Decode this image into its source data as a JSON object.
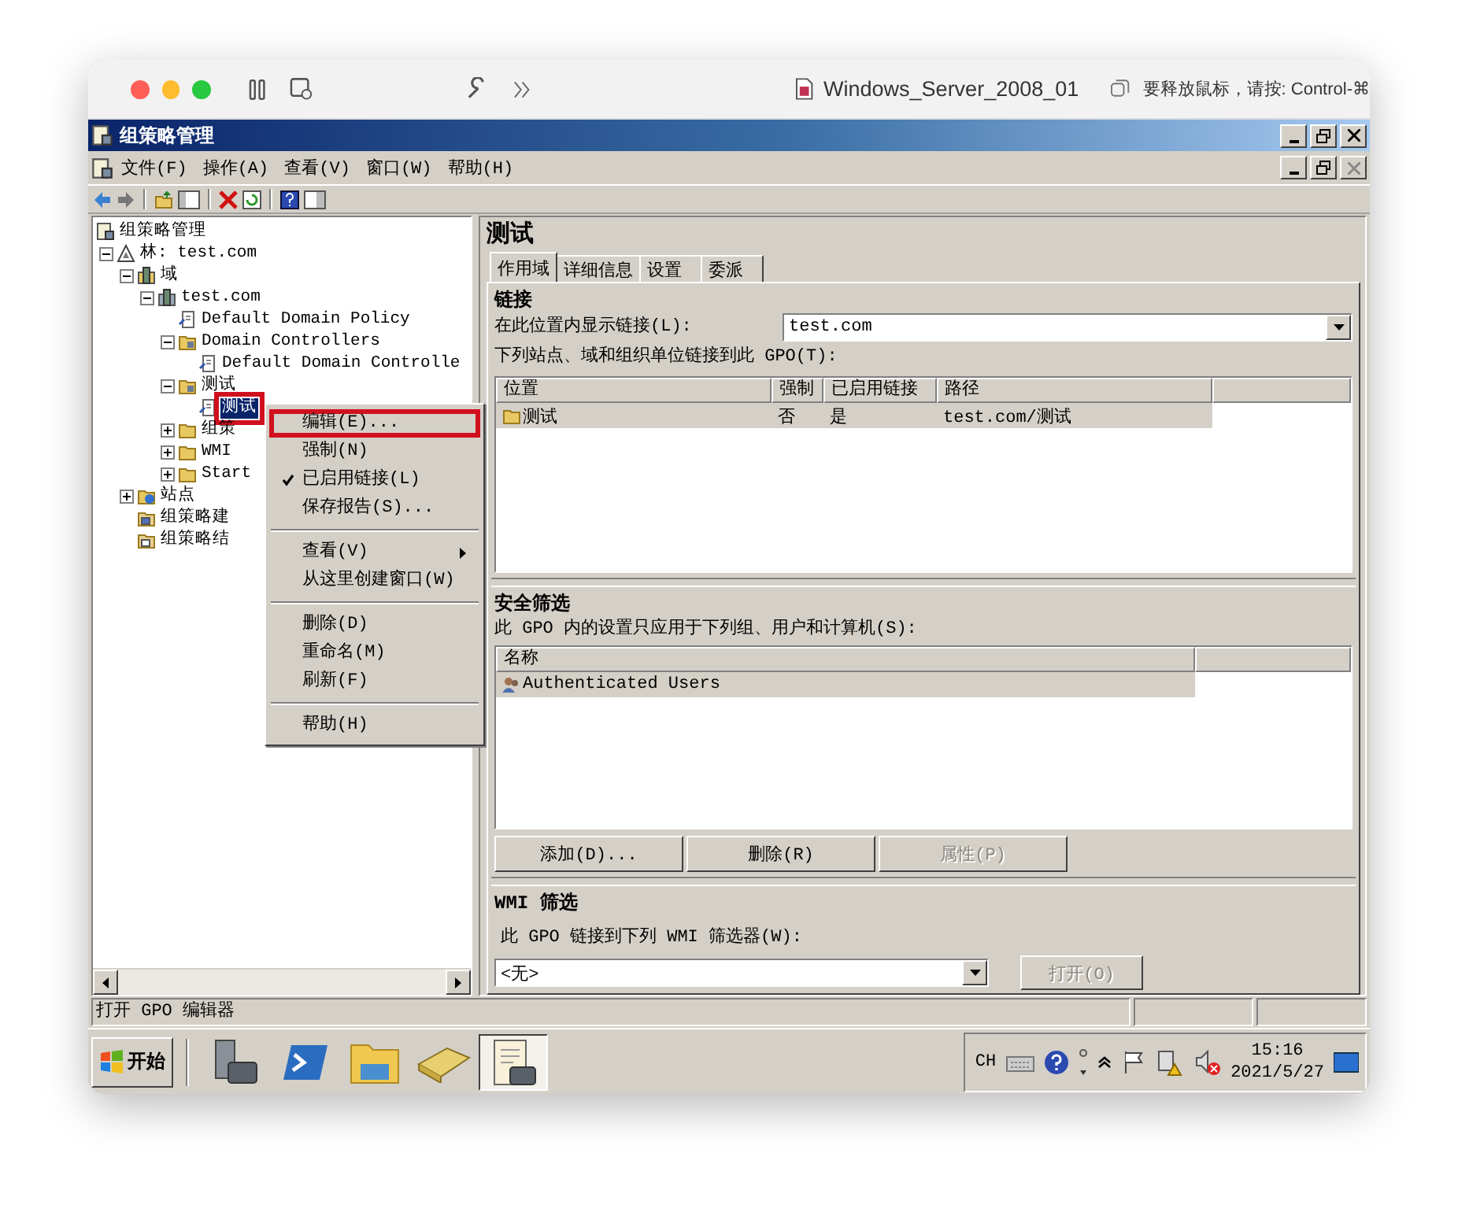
{
  "host_window": {
    "title": "Windows_Server_2008_01",
    "hint": "要释放鼠标，请按: Control-⌘"
  },
  "app_window": {
    "title": "组策略管理"
  },
  "menu_bar": [
    "文件(F)",
    "操作(A)",
    "查看(V)",
    "窗口(W)",
    "帮助(H)"
  ],
  "tree": {
    "label": "组策略管理",
    "kind": "console",
    "selected": false,
    "highlighted": false,
    "children": [
      {
        "label": "林: test.com",
        "kind": "forest",
        "expanded": true,
        "selected": false,
        "highlighted": false,
        "children": [
          {
            "label": "域",
            "kind": "domains",
            "expanded": true,
            "selected": false,
            "highlighted": false,
            "children": [
              {
                "label": "test.com",
                "kind": "domain",
                "expanded": true,
                "selected": false,
                "highlighted": false,
                "children": [
                  {
                    "label": "Default Domain Policy",
                    "kind": "gpo",
                    "selected": false,
                    "highlighted": false
                  },
                  {
                    "label": "Domain Controllers",
                    "kind": "ou",
                    "expanded": true,
                    "selected": false,
                    "highlighted": false,
                    "children": [
                      {
                        "label": "Default Domain Controlle",
                        "kind": "gpo",
                        "selected": false,
                        "highlighted": false
                      }
                    ]
                  },
                  {
                    "label": "测试",
                    "kind": "ou",
                    "expanded": true,
                    "selected": false,
                    "highlighted": false,
                    "children": [
                      {
                        "label": "测试",
                        "kind": "gpo",
                        "selected": true,
                        "highlighted": true
                      }
                    ]
                  },
                  {
                    "label": "组策",
                    "kind": "folder",
                    "expanded": false,
                    "selected": false,
                    "highlighted": false
                  },
                  {
                    "label": "WMI",
                    "kind": "folder",
                    "expanded": false,
                    "selected": false,
                    "highlighted": false
                  },
                  {
                    "label": "Start",
                    "kind": "folder",
                    "expanded": false,
                    "selected": false,
                    "highlighted": false
                  }
                ]
              }
            ]
          },
          {
            "label": "站点",
            "kind": "sites",
            "expanded": false,
            "selected": false,
            "highlighted": false
          },
          {
            "label": "组策略建",
            "kind": "modeling",
            "selected": false,
            "highlighted": false
          },
          {
            "label": "组策略结",
            "kind": "results",
            "selected": false,
            "highlighted": false
          }
        ]
      }
    ]
  },
  "details": {
    "title": "测试",
    "tabs": [
      {
        "label": "作用域",
        "selected": true
      },
      {
        "label": "详细信息",
        "selected": false
      },
      {
        "label": "设置",
        "selected": false
      },
      {
        "label": "委派",
        "selected": false
      }
    ],
    "links": {
      "heading": "链接",
      "location_label": "在此位置内显示链接(L):",
      "location_value": "test.com",
      "list_label": "下列站点、域和组织单位链接到此 GPO(T):",
      "columns": [
        "位置",
        "强制",
        "已启用链接",
        "路径"
      ],
      "rows": [
        {
          "cells": [
            "测试",
            "否",
            "是",
            "test.com/测试"
          ],
          "selected": true
        }
      ]
    },
    "security": {
      "heading": "安全筛选",
      "list_label": "此 GPO 内的设置只应用于下列组、用户和计算机(S):",
      "columns": [
        "名称"
      ],
      "rows": [
        {
          "cells": [
            "Authenticated Users"
          ],
          "selected": true
        }
      ],
      "buttons": [
        {
          "label": "添加(D)...",
          "disabled": false
        },
        {
          "label": "删除(R)",
          "disabled": false
        },
        {
          "label": "属性(P)",
          "disabled": true
        }
      ]
    },
    "wmi": {
      "heading": "WMI 筛选",
      "label": "此 GPO 链接到下列 WMI 筛选器(W):",
      "value": "<无>",
      "button": {
        "label": "打开(O)",
        "disabled": true
      }
    }
  },
  "context_menu": {
    "items": [
      {
        "kind": "item",
        "label": "编辑(E)...",
        "checked": false,
        "submenu": false,
        "highlighted": true
      },
      {
        "kind": "item",
        "label": "强制(N)",
        "checked": false,
        "submenu": false,
        "highlighted": false
      },
      {
        "kind": "item",
        "label": "已启用链接(L)",
        "checked": true,
        "submenu": false,
        "highlighted": false
      },
      {
        "kind": "item",
        "label": "保存报告(S)...",
        "checked": false,
        "submenu": false,
        "highlighted": false
      },
      {
        "kind": "separator"
      },
      {
        "kind": "item",
        "label": "查看(V)",
        "checked": false,
        "submenu": true,
        "highlighted": false
      },
      {
        "kind": "item",
        "label": "从这里创建窗口(W)",
        "checked": false,
        "submenu": false,
        "highlighted": false
      },
      {
        "kind": "separator"
      },
      {
        "kind": "item",
        "label": "删除(D)",
        "checked": false,
        "submenu": false,
        "highlighted": false
      },
      {
        "kind": "item",
        "label": "重命名(M)",
        "checked": false,
        "submenu": false,
        "highlighted": false
      },
      {
        "kind": "item",
        "label": "刷新(F)",
        "checked": false,
        "submenu": false,
        "highlighted": false
      },
      {
        "kind": "separator"
      },
      {
        "kind": "item",
        "label": "帮助(H)",
        "checked": false,
        "submenu": false,
        "highlighted": false
      }
    ]
  },
  "status_bar": "打开 GPO 编辑器",
  "taskbar": {
    "start": "开始",
    "programs": [
      {
        "kind": "server",
        "selected": false
      },
      {
        "kind": "terminal",
        "selected": false
      },
      {
        "kind": "folder",
        "selected": false
      },
      {
        "kind": "book",
        "selected": false
      },
      {
        "kind": "document",
        "selected": true
      }
    ],
    "language": "CH",
    "time": "15:16",
    "date": "2021/5/27"
  }
}
